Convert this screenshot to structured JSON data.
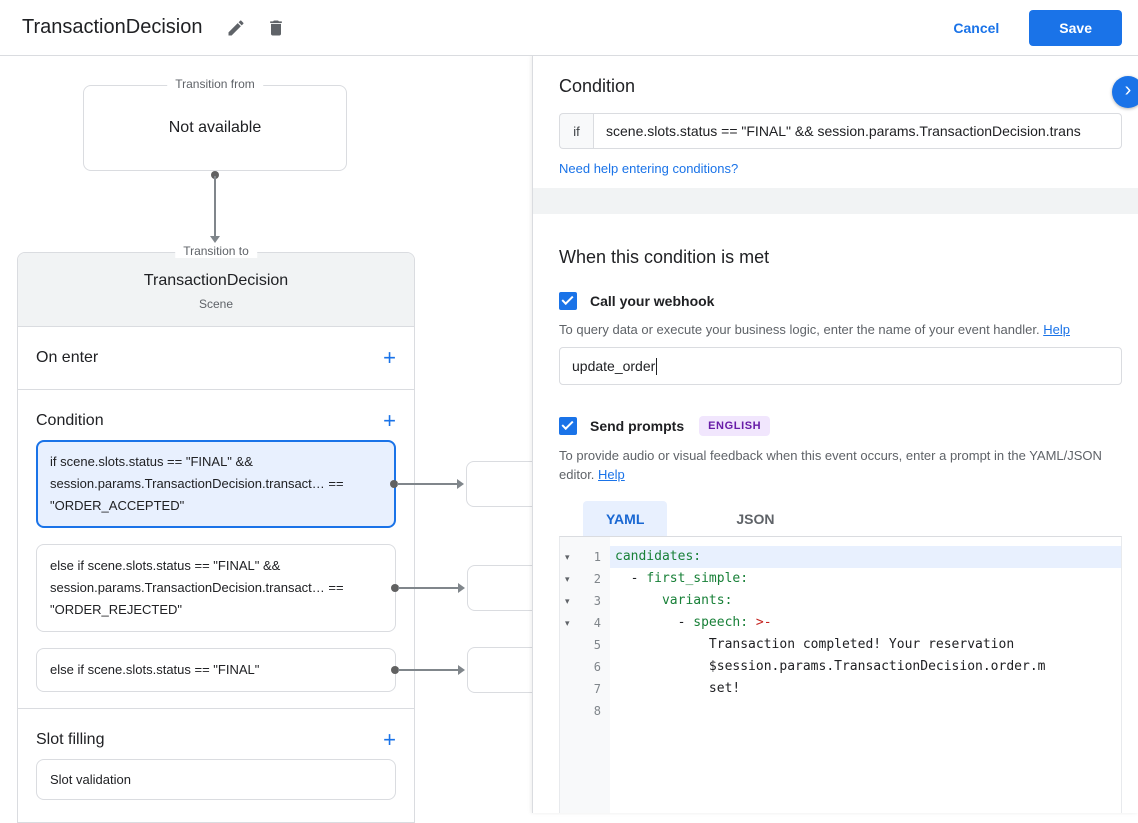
{
  "colors": {
    "accent": "#1a73e8",
    "selected_bg": "#e8f0fe",
    "badge_bg": "#f1e6fd",
    "badge_text": "#681da8",
    "yaml_key": "#188038",
    "yaml_indicator": "#c5221f"
  },
  "icons": {
    "edit": "pencil-icon",
    "delete": "trash-icon",
    "panel_toggle": "chevron-right-icon",
    "add": "+",
    "chevron": "›"
  },
  "header": {
    "title": "TransactionDecision",
    "cancel_label": "Cancel",
    "save_label": "Save"
  },
  "diagram": {
    "transition_from": {
      "label": "Transition from",
      "content": "Not available"
    },
    "transition_to": {
      "label": "Transition to",
      "title": "TransactionDecision",
      "subtitle": "Scene"
    },
    "on_enter_label": "On enter",
    "condition_label": "Condition",
    "slot_filling_label": "Slot filling",
    "conditions": [
      {
        "text": "if scene.slots.status == \"FINAL\" && session.params.TransactionDecision.transact… == \"ORDER_ACCEPTED\"",
        "selected": true
      },
      {
        "text": "else if scene.slots.status == \"FINAL\" && session.params.TransactionDecision.transact… == \"ORDER_REJECTED\"",
        "selected": false
      },
      {
        "text": "else if scene.slots.status == \"FINAL\"",
        "selected": false
      }
    ],
    "slot_validation_label": "Slot validation"
  },
  "panel": {
    "title": "Condition",
    "if_label": "if",
    "condition_value": "scene.slots.status == \"FINAL\" && session.params.TransactionDecision.trans",
    "conditions_help_link": "Need help entering conditions?",
    "when_met_title": "When this condition is met",
    "webhook": {
      "label": "Call your webhook",
      "checked": true,
      "description": "To query data or execute your business logic, enter the name of your event handler.",
      "help_label": "Help",
      "value": "update_order"
    },
    "prompts": {
      "label": "Send prompts",
      "checked": true,
      "badge": "ENGLISH",
      "description": "To provide audio or visual feedback when this event occurs, enter a prompt in the YAML/JSON editor.",
      "help_label": "Help"
    },
    "tabs": [
      {
        "label": "YAML",
        "active": true
      },
      {
        "label": "JSON",
        "active": false
      }
    ],
    "editor": {
      "lines": [
        {
          "num": "1",
          "fold": "▾",
          "pre": "",
          "key": "candidates:",
          "op": "",
          "text": "",
          "highlight": true
        },
        {
          "num": "2",
          "fold": "▾",
          "pre": "  - ",
          "key": "first_simple:",
          "op": "",
          "text": ""
        },
        {
          "num": "3",
          "fold": "▾",
          "pre": "      ",
          "key": "variants:",
          "op": "",
          "text": ""
        },
        {
          "num": "4",
          "fold": "▾",
          "pre": "        - ",
          "key": "speech:",
          "op": " >-",
          "text": ""
        },
        {
          "num": "5",
          "fold": "",
          "pre": "            ",
          "key": "",
          "op": "",
          "text": "Transaction completed! Your reservation"
        },
        {
          "num": "6",
          "fold": "",
          "pre": "            ",
          "key": "",
          "op": "",
          "text": "$session.params.TransactionDecision.order.m"
        },
        {
          "num": "7",
          "fold": "",
          "pre": "            ",
          "key": "",
          "op": "",
          "text": "set!"
        },
        {
          "num": "8",
          "fold": "",
          "pre": "",
          "key": "",
          "op": "",
          "text": ""
        }
      ]
    }
  }
}
